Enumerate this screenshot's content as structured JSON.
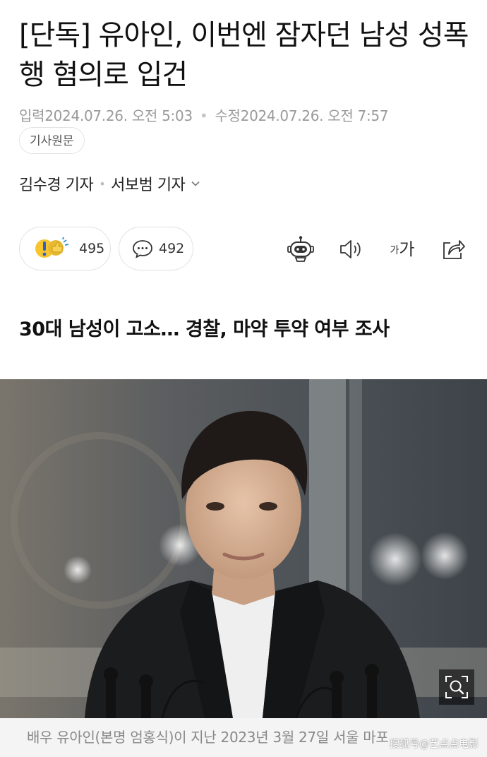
{
  "article": {
    "headline": "[단독] 유아인, 이번엔 잠자던 남성 성폭행 혐의로 입건",
    "input_label": "입력",
    "input_date": "2024.07.26. 오전 5:03",
    "separator": "•",
    "modified_label": "수정",
    "modified_date": "2024.07.26. 오전 7:57",
    "original_button": "기사원문",
    "reporters": [
      "김수경 기자",
      "서보범 기자"
    ],
    "subheadline": "30대 남성이 고소… 경찰, 마약 투약 여부 조사",
    "caption": "배우 유아인(본명 엄홍식)이 지난 2023년 3월 27일 서울 마포"
  },
  "reactions": {
    "like_count": "495",
    "comment_count": "492"
  },
  "toolbar": {
    "icons": [
      "robot-summary-icon",
      "speaker-icon",
      "font-size-icon",
      "share-icon"
    ],
    "font_small": "가",
    "font_large": "가"
  },
  "photo": {
    "icon": "zoom-icon"
  },
  "watermark": "搜狐号@艺点点电影"
}
